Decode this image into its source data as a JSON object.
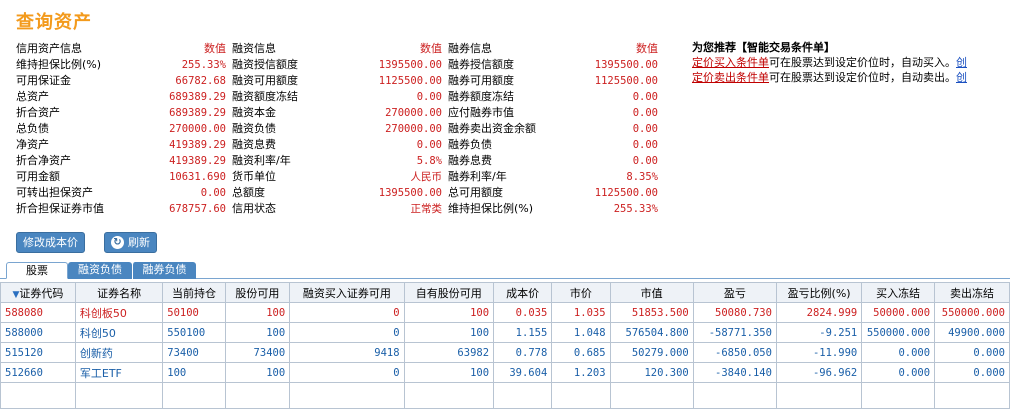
{
  "page_title": "查询资产",
  "credit": {
    "header": {
      "label": "信用资产信息",
      "value": "数值"
    },
    "rows": [
      {
        "label": "维持担保比例(%)",
        "value": "255.33%"
      },
      {
        "label": "可用保证金",
        "value": "66782.68"
      },
      {
        "label": "总资产",
        "value": "689389.29"
      },
      {
        "label": "折合资产",
        "value": "689389.29"
      },
      {
        "label": "总负债",
        "value": "270000.00"
      },
      {
        "label": "净资产",
        "value": "419389.29"
      },
      {
        "label": "折合净资产",
        "value": "419389.29"
      },
      {
        "label": "可用金额",
        "value": "10631.690"
      },
      {
        "label": "可转出担保资产",
        "value": "0.00"
      },
      {
        "label": "折合担保证券市值",
        "value": "678757.60"
      }
    ]
  },
  "financing": {
    "header": {
      "label": "融资信息",
      "value": "数值"
    },
    "rows": [
      {
        "label": "融资授信额度",
        "value": "1395500.00"
      },
      {
        "label": "融资可用额度",
        "value": "1125500.00"
      },
      {
        "label": "融资额度冻结",
        "value": "0.00"
      },
      {
        "label": "融资本金",
        "value": "270000.00"
      },
      {
        "label": "融资负债",
        "value": "270000.00"
      },
      {
        "label": "融资息费",
        "value": "0.00"
      },
      {
        "label": "融资利率/年",
        "value": "5.8%"
      },
      {
        "label": "货币单位",
        "value": "人民币"
      },
      {
        "label": "总额度",
        "value": "1395500.00"
      },
      {
        "label": "信用状态",
        "value": "正常类"
      }
    ]
  },
  "securities": {
    "header": {
      "label": "融券信息",
      "value": "数值"
    },
    "rows": [
      {
        "label": "融券授信额度",
        "value": "1395500.00"
      },
      {
        "label": "融券可用额度",
        "value": "1125500.00"
      },
      {
        "label": "融券额度冻结",
        "value": "0.00"
      },
      {
        "label": "应付融券市值",
        "value": "0.00"
      },
      {
        "label": "融券卖出资金余额",
        "value": "0.00"
      },
      {
        "label": "融券负债",
        "value": "0.00"
      },
      {
        "label": "融券息费",
        "value": "0.00"
      },
      {
        "label": "融券利率/年",
        "value": "8.35%"
      },
      {
        "label": "总可用额度",
        "value": "1125500.00"
      },
      {
        "label": "维持担保比例(%)",
        "value": "255.33%"
      }
    ]
  },
  "recommend": {
    "title": "为您推荐【智能交易条件单】",
    "buy_link": "定价买入条件单",
    "buy_text": "可在股票达到设定价位时，自动买入。",
    "buy_more": "创",
    "sell_link": "定价卖出条件单",
    "sell_text": "可在股票达到设定价位时，自动卖出。",
    "sell_more": "创"
  },
  "buttons": {
    "edit_cost": "修改成本价",
    "refresh": "刷新"
  },
  "tabs": [
    "股票",
    "融资负债",
    "融券负债"
  ],
  "table": {
    "columns": [
      "证券代码",
      "证券名称",
      "当前持仓",
      "股份可用",
      "融资买入证券可用",
      "自有股份可用",
      "成本价",
      "市价",
      "市值",
      "盈亏",
      "盈亏比例(%)",
      "买入冻结",
      "卖出冻结"
    ],
    "rows": [
      {
        "color": "red",
        "cells": [
          "588080",
          "科创板50",
          "50100",
          "100",
          "0",
          "100",
          "0.035",
          "1.035",
          "51853.500",
          "50080.730",
          "2824.999",
          "50000.000",
          "550000.000"
        ]
      },
      {
        "color": "blue",
        "cells": [
          "588000",
          "科创50",
          "550100",
          "100",
          "0",
          "100",
          "1.155",
          "1.048",
          "576504.800",
          "-58771.350",
          "-9.251",
          "550000.000",
          "49900.000"
        ]
      },
      {
        "color": "blue",
        "cells": [
          "515120",
          "创新药",
          "73400",
          "73400",
          "9418",
          "63982",
          "0.778",
          "0.685",
          "50279.000",
          "-6850.050",
          "-11.990",
          "0.000",
          "0.000"
        ]
      },
      {
        "color": "blue",
        "cells": [
          "512660",
          "军工ETF",
          "100",
          "100",
          "0",
          "100",
          "39.604",
          "1.203",
          "120.300",
          "-3840.140",
          "-96.962",
          "0.000",
          "0.000"
        ]
      }
    ]
  }
}
